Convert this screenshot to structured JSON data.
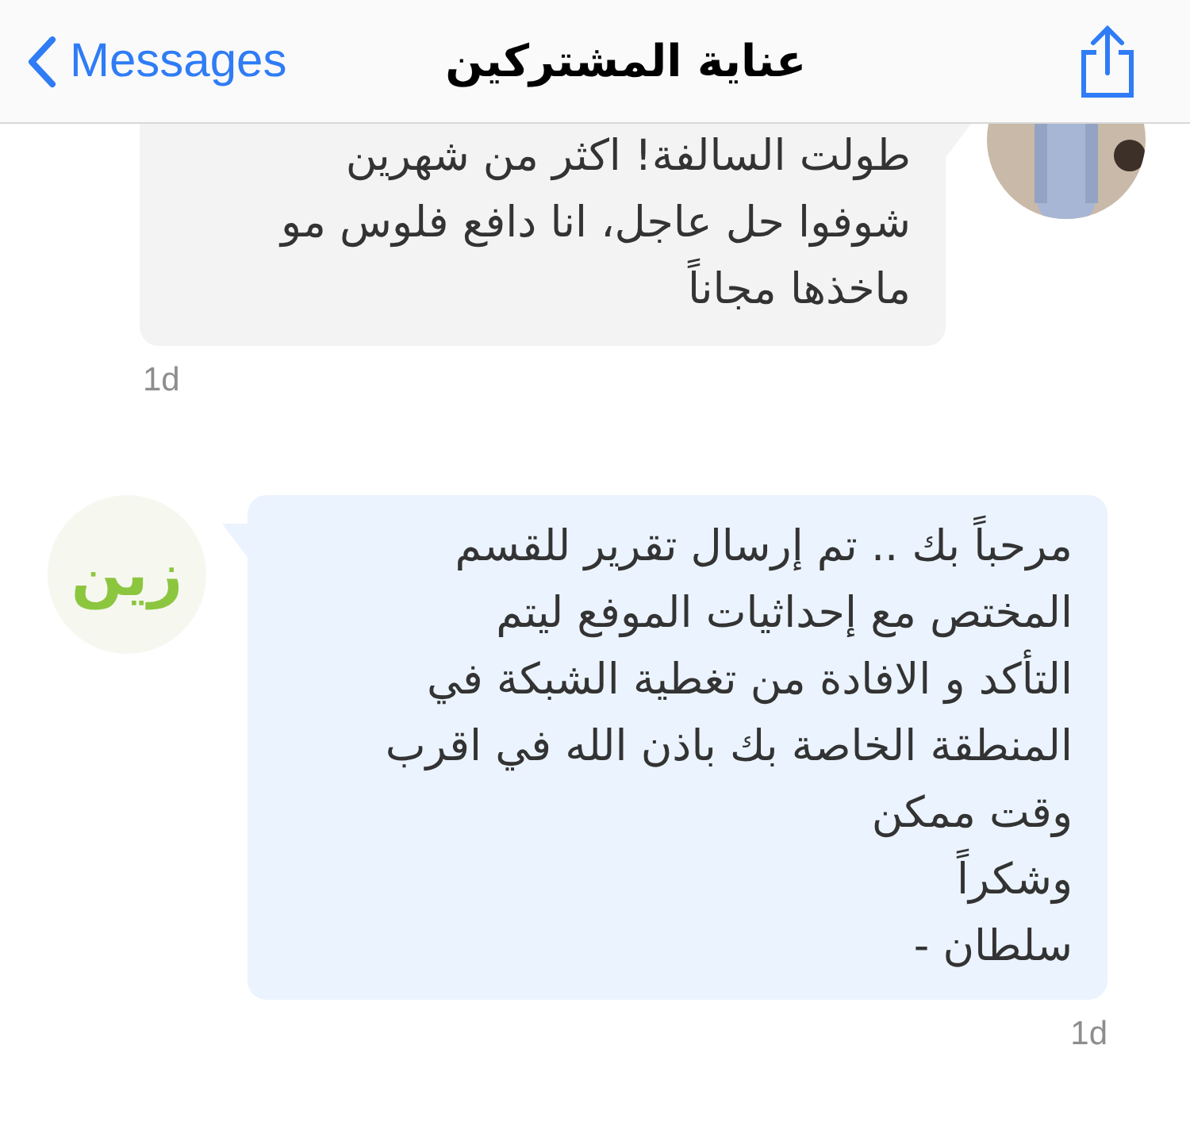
{
  "nav": {
    "back_label": "Messages",
    "title": "عناية المشتركين"
  },
  "messages": [
    {
      "kind": "outgoing",
      "text": "طولت السالفة! اكثر من شهرين\nشوفوا حل عاجل، انا دافع فلوس مو\nماخذها مجاناً",
      "time": "1d"
    },
    {
      "kind": "incoming",
      "avatar": {
        "kind": "logo",
        "text": "زين"
      },
      "text": "مرحباً بك .. تم إرسال تقرير للقسم\nالمختص مع إحداثيات الموفع ليتم\nالتأكد و الافادة من تغطية الشبكة في\nالمنطقة الخاصة بك باذن الله في اقرب\nوقت ممكن\nوشكراً\nسلطان -",
      "time": "1d"
    }
  ]
}
